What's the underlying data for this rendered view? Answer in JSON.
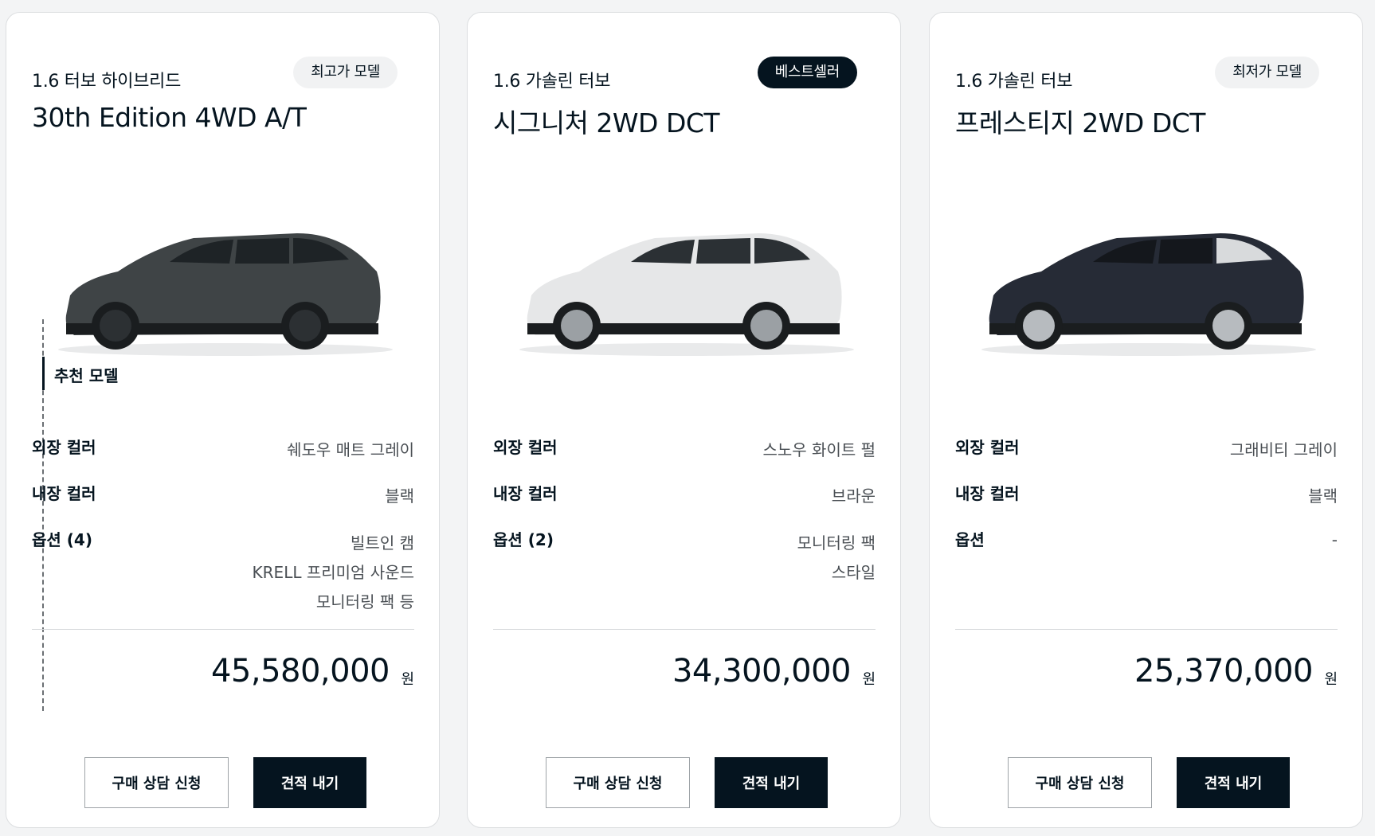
{
  "cards": [
    {
      "trim": "1.6 터보 하이브리드",
      "name": "30th Edition 4WD A/T",
      "badge": "최고가 모델",
      "badge_style": "light",
      "recommended": "추천 모델",
      "car_color": "#3f4446",
      "specs": [
        {
          "label": "외장 컬러",
          "value": [
            "쉐도우 매트 그레이"
          ]
        },
        {
          "label": "내장 컬러",
          "value": [
            "블랙"
          ]
        },
        {
          "label": "옵션 (4)",
          "value": [
            "빌트인 캠",
            "KRELL 프리미엄 사운드",
            "모니터링 팩 등"
          ]
        }
      ],
      "price": "45,580,000",
      "currency": "원",
      "consult_button": "구매 상담 신청",
      "quote_button": "견적 내기"
    },
    {
      "trim": "1.6 가솔린 터보",
      "name": "시그니처 2WD DCT",
      "badge": "베스트셀러",
      "badge_style": "dark",
      "car_color": "#e6e7e8",
      "specs": [
        {
          "label": "외장 컬러",
          "value": [
            "스노우 화이트 펄"
          ]
        },
        {
          "label": "내장 컬러",
          "value": [
            "브라운"
          ]
        },
        {
          "label": "옵션 (2)",
          "value": [
            "모니터링 팩",
            "스타일"
          ]
        }
      ],
      "price": "34,300,000",
      "currency": "원",
      "consult_button": "구매 상담 신청",
      "quote_button": "견적 내기"
    },
    {
      "trim": "1.6 가솔린 터보",
      "name": "프레스티지 2WD DCT",
      "badge": "최저가 모델",
      "badge_style": "light",
      "car_color": "#262b36",
      "specs": [
        {
          "label": "외장 컬러",
          "value": [
            "그래비티 그레이"
          ]
        },
        {
          "label": "내장 컬러",
          "value": [
            "블랙"
          ]
        },
        {
          "label": "옵션",
          "value": [
            "-"
          ]
        }
      ],
      "price": "25,370,000",
      "currency": "원",
      "consult_button": "구매 상담 신청",
      "quote_button": "견적 내기"
    }
  ]
}
